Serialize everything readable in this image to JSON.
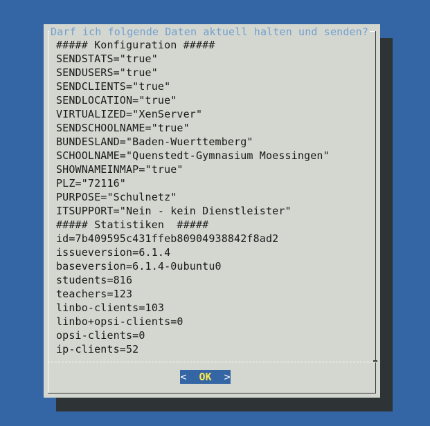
{
  "dialog": {
    "title": "Darf ich folgende Daten aktuell halten und senden?",
    "lines": [
      "##### Konfiguration #####",
      "SENDSTATS=\"true\"",
      "SENDUSERS=\"true\"",
      "SENDCLIENTS=\"true\"",
      "SENDLOCATION=\"true\"",
      "VIRTUALIZED=\"XenServer\"",
      "SENDSCHOOLNAME=\"true\"",
      "BUNDESLAND=\"Baden-Wuerttemberg\"",
      "SCHOOLNAME=\"Quenstedt-Gymnasium Moessingen\"",
      "SHOWNAMEINMAP=\"true\"",
      "PLZ=\"72116\"",
      "PURPOSE=\"Schulnetz\"",
      "ITSUPPORT=\"Nein - kein Dienstleister\"",
      "##### Statistiken  #####",
      "id=7b409595c431ffeb80904938842f8ad2",
      "issueversion=6.1.4",
      "baseversion=6.1.4-0ubuntu0",
      "students=816",
      "teachers=123",
      "linbo-clients=103",
      "linbo+opsi-clients=0",
      "opsi-clients=0",
      "ip-clients=52"
    ],
    "button": {
      "left_bracket": "<",
      "label": "OK",
      "right_bracket": ">"
    }
  },
  "colors": {
    "desktop_background": "#3465a4",
    "dialog_background": "#d3d7cf",
    "shadow": "#2e3436",
    "title_text": "#729fcf",
    "button_background": "#3465a4",
    "button_label": "#fce94f"
  }
}
